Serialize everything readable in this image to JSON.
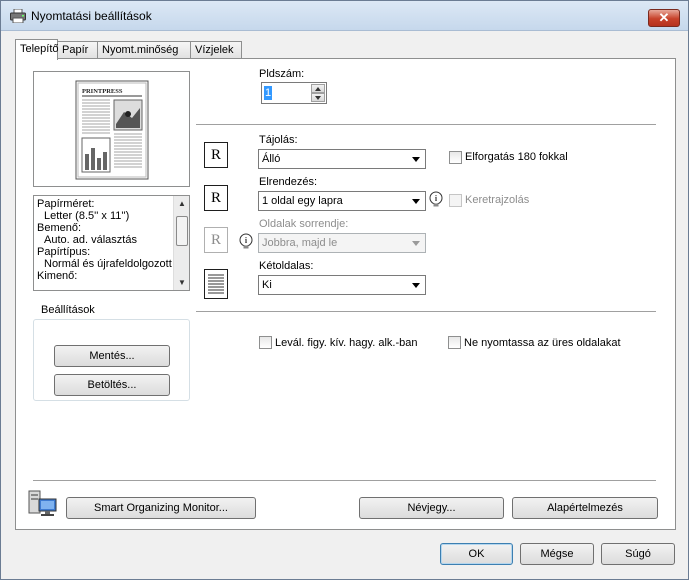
{
  "window": {
    "title": "Nyomtatási beállítások",
    "close_label": "✕"
  },
  "tabs": [
    {
      "label": "Telepítő"
    },
    {
      "label": "Papír"
    },
    {
      "label": "Nyomt.minőség"
    },
    {
      "label": "Vízjelek"
    }
  ],
  "preview": {
    "newspaper_title": "PRINTPRESS"
  },
  "info_lines": [
    "Papírméret:",
    "Letter (8.5'' x 11'')",
    "Bemenő:",
    "Auto. ad. választás",
    "Papírtípus:",
    "Normál és újrafeldolgozott",
    "Kimenő:"
  ],
  "settings_group": {
    "title": "Beállítások",
    "save_label": "Mentés...",
    "load_label": "Betöltés..."
  },
  "copies": {
    "label": "Pldszám:",
    "value": "1"
  },
  "orientation": {
    "label": "Tájolás:",
    "value": "Álló",
    "rotate_label": "Elforgatás 180 fokkal",
    "rotate_checked": false
  },
  "layout": {
    "label": "Elrendezés:",
    "value": "1 oldal egy lapra",
    "border_label": "Keretrajzolás",
    "border_checked": false
  },
  "page_order": {
    "label": "Oldalak sorrendje:",
    "value": "Jobbra, majd le"
  },
  "duplex": {
    "label": "Kétoldalas:",
    "value": "Ki"
  },
  "options": {
    "separate_label": "Levál. figy. kív. hagy. alk.-ban",
    "skip_blank_label": "Ne nyomtassa az üres oldalakat"
  },
  "bottom_buttons": {
    "monitor_label": "Smart Organizing Monitor...",
    "about_label": "Névjegy...",
    "default_label": "Alapértelmezés"
  },
  "dialog_buttons": {
    "ok": "OK",
    "cancel": "Mégse",
    "help": "Súgó"
  },
  "icon_letter": "R"
}
